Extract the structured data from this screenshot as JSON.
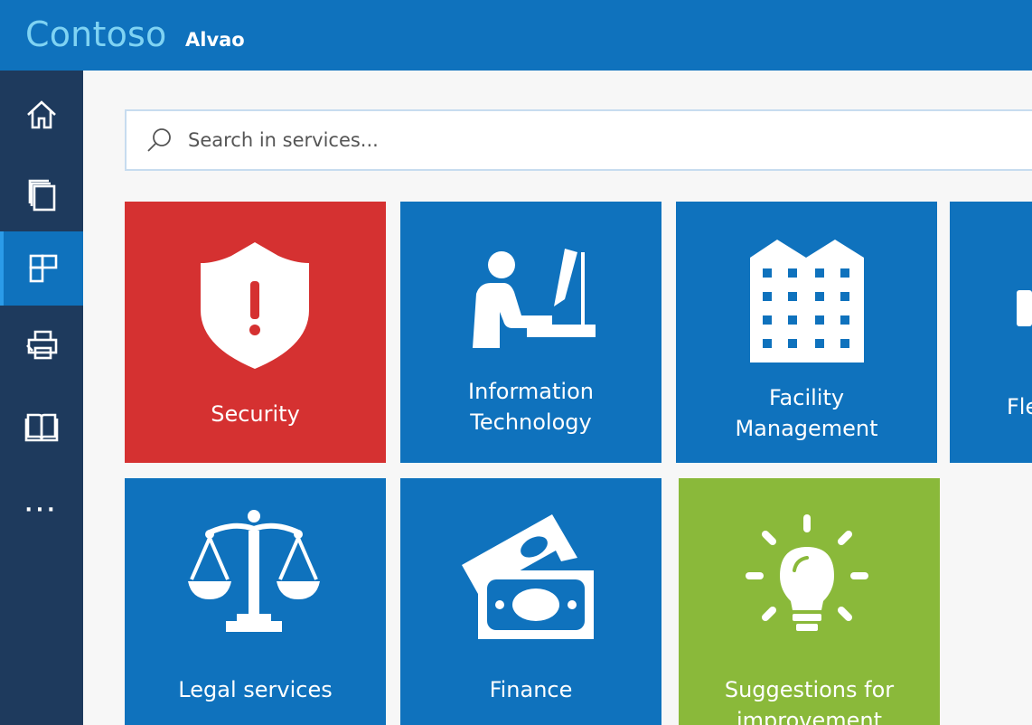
{
  "header": {
    "brand": "Contoso",
    "app_name": "Alvao"
  },
  "sidebar": {
    "items": [
      {
        "name": "home",
        "icon": "home-icon"
      },
      {
        "name": "requests",
        "icon": "copy-pages-icon"
      },
      {
        "name": "services",
        "icon": "tiles-icon",
        "active": true
      },
      {
        "name": "printer",
        "icon": "printer-icon"
      },
      {
        "name": "knowledge-base",
        "icon": "book-icon"
      }
    ],
    "more": "···"
  },
  "search": {
    "placeholder": "Search in services...",
    "value": "",
    "icon": "search-icon"
  },
  "tiles": [
    {
      "label_lines": [
        "Security"
      ],
      "color": "#d53131",
      "icon": "shield-alert-icon"
    },
    {
      "label_lines": [
        "Information",
        "Technology"
      ],
      "color": "#0f72bd",
      "icon": "person-computer-icon"
    },
    {
      "label_lines": [
        "Facility",
        "Management"
      ],
      "color": "#0f72bd",
      "icon": "building-icon"
    },
    {
      "label_lines": [
        "Fle"
      ],
      "color": "#0f72bd",
      "icon": "partial-icon"
    },
    {
      "label_lines": [
        "Legal services"
      ],
      "color": "#0f72bd",
      "icon": "scales-icon"
    },
    {
      "label_lines": [
        "Finance"
      ],
      "color": "#0f72bd",
      "icon": "money-icon"
    },
    {
      "label_lines": [
        "Suggestions for",
        "improvement"
      ],
      "color": "#8ab93a",
      "icon": "lightbulb-icon"
    }
  ],
  "colors": {
    "header": "#0f72bd",
    "sidebar": "#1e3a5d",
    "brand_text": "#7fd3f3"
  }
}
